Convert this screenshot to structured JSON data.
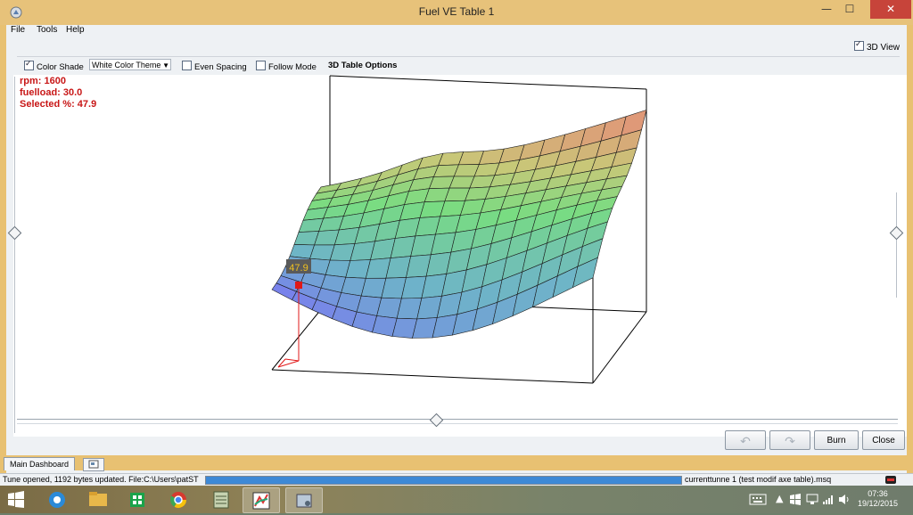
{
  "window": {
    "title": "Fuel VE Table 1",
    "minimize_label": "—",
    "maximize_label": "☐",
    "close_label": "✕"
  },
  "menu": {
    "file": "File",
    "tools": "Tools",
    "help": "Help"
  },
  "view_toggle": {
    "label": "3D View",
    "checked": true
  },
  "options": {
    "color_shade_label": "Color Shade",
    "color_shade_checked": true,
    "theme_selected": "White Color Theme",
    "even_spacing_label": "Even Spacing",
    "even_spacing_checked": false,
    "follow_mode_label": "Follow Mode",
    "follow_mode_checked": false,
    "table_options_label": "3D Table Options"
  },
  "readout": {
    "rpm": "rpm: 1600",
    "fuelload": "fuelload: 30.0",
    "selected": "Selected %: 47.9"
  },
  "selected_cell": {
    "value_label": "47.9"
  },
  "buttons": {
    "undo_label": "↶",
    "redo_label": "↷",
    "burn_label": "Burn",
    "close_label": "Close"
  },
  "tabs": {
    "main_dashboard": "Main Dashboard"
  },
  "status": {
    "message": "Tune opened, 1192 bytes updated. File:C:\\Users\\patST",
    "file": "currenttunne 1 (test modif axe table).msq",
    "progress": 1.0
  },
  "taskbar": {
    "time": "07:36",
    "date": "19/12/2015"
  },
  "colors": {
    "title_bar": "#e7c27a",
    "readout_text": "#c81717",
    "progress_fill": "#3d89d6",
    "selected_marker": "#e01818",
    "label_bg": "#f0c020"
  }
}
